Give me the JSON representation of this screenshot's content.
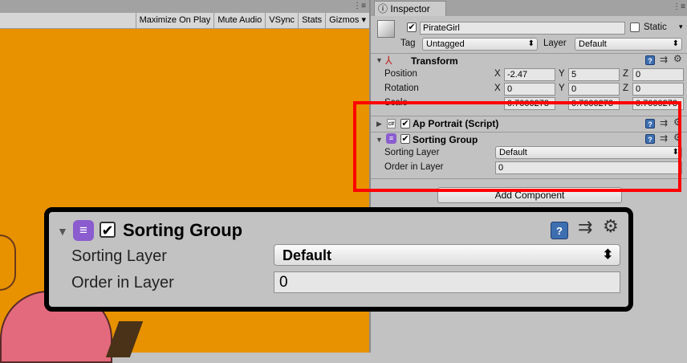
{
  "game": {
    "toolbar": [
      "Maximize On Play",
      "Mute Audio",
      "VSync",
      "Stats",
      "Gizmos"
    ],
    "menu_glyph": "⋮≡"
  },
  "inspector": {
    "tab_title": "Inspector",
    "tab_icon": "info-icon",
    "menu_glyph": "⋮≡",
    "object_name": "PirateGirl",
    "object_active": true,
    "static_label": "Static",
    "tag_label": "Tag",
    "tag_value": "Untagged",
    "layer_label": "Layer",
    "layer_value": "Default",
    "transform": {
      "title": "Transform",
      "rows": [
        {
          "label": "Position",
          "x": "-2.47",
          "y": "5",
          "z": "0"
        },
        {
          "label": "Rotation",
          "x": "0",
          "y": "0",
          "z": "0"
        },
        {
          "label": "Scale",
          "x": "0.7000273",
          "y": "0.7000273",
          "z": "0.7000273"
        }
      ],
      "axis_x": "X",
      "axis_y": "Y",
      "axis_z": "Z"
    },
    "ap_portrait": {
      "title": "Ap Portrait (Script)",
      "enabled": true,
      "icon_text": "c#"
    },
    "sorting_group": {
      "title": "Sorting Group",
      "enabled": true,
      "sorting_layer_label": "Sorting Layer",
      "sorting_layer_value": "Default",
      "order_label": "Order in Layer",
      "order_value": "0"
    },
    "add_component": "Add Component"
  },
  "zoom": {
    "title": "Sorting Group",
    "sorting_layer_label": "Sorting Layer",
    "sorting_layer_value": "Default",
    "order_label": "Order in Layer",
    "order_value": "0"
  },
  "colors": {
    "game_bg": "#e89200",
    "highlight": "#ff0000",
    "panel_bg": "#c2c2c2"
  }
}
